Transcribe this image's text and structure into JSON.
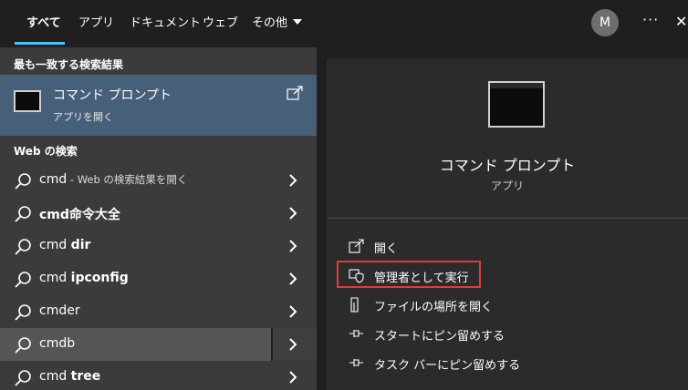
{
  "tabs": [
    {
      "label": "すべて",
      "active": true
    },
    {
      "label": "アプリ"
    },
    {
      "label": "ドキュメント"
    },
    {
      "label": "ウェブ"
    },
    {
      "label": "その他"
    }
  ],
  "user": {
    "initial": "M"
  },
  "header_actions": {
    "more_glyph": "···",
    "close_glyph": "✕"
  },
  "left": {
    "best_match_heading": "最も一致する検索結果",
    "best_match": {
      "title": "コマンド プロンプト",
      "subtitle": "アプリを開く",
      "icon": "terminal-icon"
    },
    "web_heading": "Web の検索",
    "results": [
      {
        "query": "cmd",
        "suffix": " - Web の検索結果を開く",
        "bold": false
      },
      {
        "query": "cmd命令大全",
        "suffix": "",
        "bold": true
      },
      {
        "query": "cmd ",
        "bold_part": "dir",
        "bold": true
      },
      {
        "query": "cmd ",
        "bold_part": "ipconfig",
        "bold": true
      },
      {
        "query": "cmder",
        "suffix": "",
        "bold": false
      },
      {
        "query": "cmdb",
        "suffix": "",
        "bold": false,
        "selected": true
      },
      {
        "query": "cmd ",
        "bold_part": "tree",
        "bold": true
      }
    ]
  },
  "right": {
    "title": "コマンド プロンプト",
    "subtitle": "アプリ",
    "actions": [
      {
        "label": "開く",
        "icon": "open-external-icon"
      },
      {
        "label": "管理者として実行",
        "icon": "shield-admin-icon",
        "highlighted": true
      },
      {
        "label": "ファイルの場所を開く",
        "icon": "file-location-icon"
      },
      {
        "label": "スタートにピン留めする",
        "icon": "pin-icon"
      },
      {
        "label": "タスク バーにピン留めする",
        "icon": "pin-icon"
      }
    ]
  },
  "colors": {
    "accent": "#4cc2ff",
    "best_match_bg": "#47607a",
    "highlight": "#e23a3a"
  }
}
